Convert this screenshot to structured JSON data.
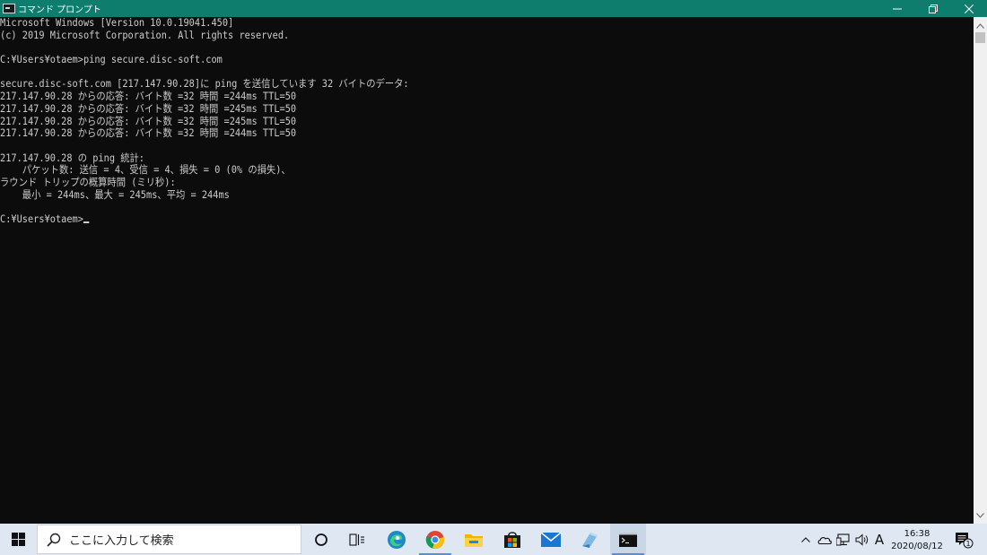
{
  "window": {
    "title": "コマンド プロンプト",
    "minimize_symbol": "─",
    "maximize_symbol": "🗗",
    "close_symbol": "✕"
  },
  "console": {
    "lines": [
      "Microsoft Windows [Version 10.0.19041.450]",
      "(c) 2019 Microsoft Corporation. All rights reserved.",
      "",
      "C:¥Users¥otaem>ping secure.disc-soft.com",
      "",
      "secure.disc-soft.com [217.147.90.28]に ping を送信しています 32 バイトのデータ:",
      "217.147.90.28 からの応答: バイト数 =32 時間 =244ms TTL=50",
      "217.147.90.28 からの応答: バイト数 =32 時間 =245ms TTL=50",
      "217.147.90.28 からの応答: バイト数 =32 時間 =245ms TTL=50",
      "217.147.90.28 からの応答: バイト数 =32 時間 =244ms TTL=50",
      "",
      "217.147.90.28 の ping 統計:",
      "    パケット数: 送信 = 4、受信 = 4、損失 = 0 (0% の損失)、",
      "ラウンド トリップの概算時間 (ミリ秒):",
      "    最小 = 244ms、最大 = 245ms、平均 = 244ms",
      ""
    ],
    "prompt": "C:¥Users¥otaem>"
  },
  "taskbar": {
    "search_placeholder": "ここに入力して検索",
    "apps": [
      {
        "name": "cortana-icon"
      },
      {
        "name": "task-view-icon"
      },
      {
        "name": "edge-icon"
      },
      {
        "name": "chrome-icon"
      },
      {
        "name": "file-explorer-icon"
      },
      {
        "name": "microsoft-store-icon"
      },
      {
        "name": "mail-icon"
      },
      {
        "name": "app-icon"
      },
      {
        "name": "command-prompt-icon"
      }
    ],
    "ime_indicator": "A",
    "clock_time": "16:38",
    "clock_date": "2020/08/12",
    "notification_count": "1"
  },
  "colors": {
    "titlebar": "#0e7d6e",
    "console_bg": "#0c0c0c",
    "console_text": "#cccccc",
    "taskbar_bg": "#dfe8f2"
  }
}
